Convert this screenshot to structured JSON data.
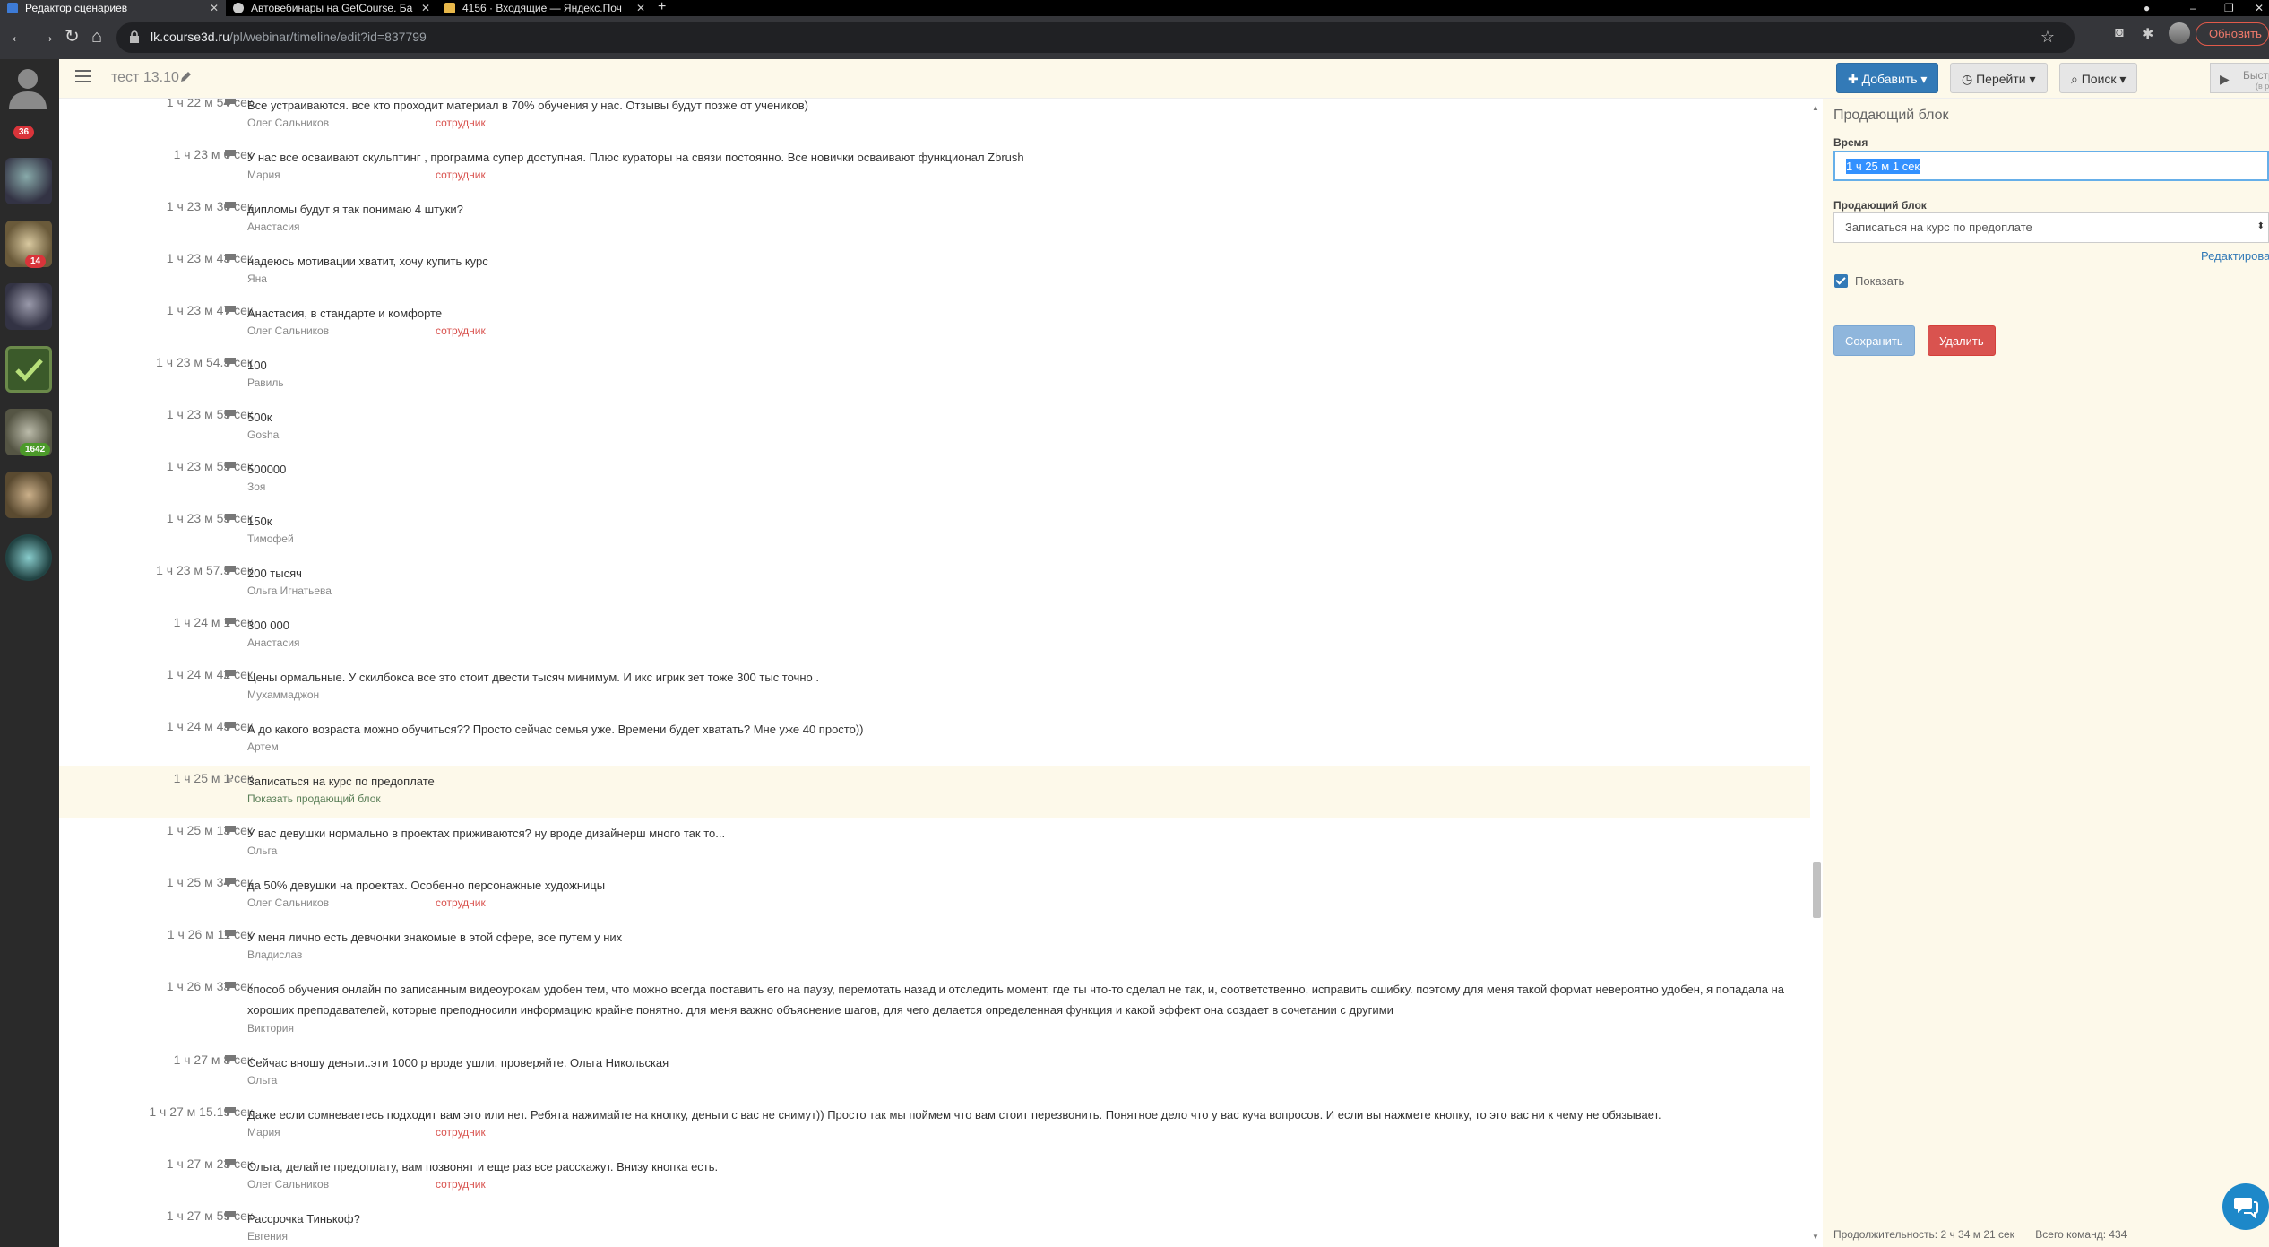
{
  "browser": {
    "tabs": [
      {
        "title": "Редактор сценариев",
        "active": true,
        "favicon_color": "#3d7bd6"
      },
      {
        "title": "Автовебинары на GetCourse. Ба",
        "active": false,
        "favicon_color": "#cccccc"
      },
      {
        "title": "4156 · Входящие — Яндекс.Поч",
        "active": false,
        "favicon_color": "#e8b84a"
      }
    ],
    "new_tab": "+",
    "url_host": "lk.course3d.ru",
    "url_path": "/pl/webinar/timeline/edit?id=837799",
    "update_label": "Обновить",
    "icons": [
      "back-icon",
      "forward-icon",
      "reload-icon",
      "home-icon",
      "lock-icon",
      "star-icon",
      "camera-icon",
      "puzzle-icon"
    ]
  },
  "sidebar": {
    "badges": [
      {
        "label": "36",
        "color": "#d9343a"
      },
      {
        "label": "14",
        "color": "#d9343a"
      },
      {
        "label": "1642",
        "color": "#4c9a2a"
      }
    ]
  },
  "header": {
    "title": "тест 13.10",
    "add_label": "Добавить",
    "goto_label": "Перейти",
    "search_label": "Поиск",
    "quick_check": "Быстрая проверка",
    "quick_check_sub": "(в разработке)"
  },
  "timeline": {
    "rows": [
      {
        "time": "1 ч 22 м 54 сек",
        "text": "Все устраиваются. все кто проходит материал в 70% обучения у нас. Отзывы будут позже от учеников)",
        "author": "Олег Сальников",
        "role": "сотрудник"
      },
      {
        "time": "1 ч 23 м 6 сек",
        "text": "У нас все осваивают скульптинг , программа супер доступная. Плюс кураторы на связи постоянно. Все новички осваивают функционал Zbrush",
        "author": "Мария",
        "role": "сотрудник"
      },
      {
        "time": "1 ч 23 м 36 сек",
        "text": "дипломы будут я так понимаю 4 штуки?",
        "author": "Анастасия",
        "role": ""
      },
      {
        "time": "1 ч 23 м 43 сек",
        "text": "надеюсь мотивации хватит, хочу купить курс",
        "author": "Яна",
        "role": ""
      },
      {
        "time": "1 ч 23 м 47 сек",
        "text": "Анастасия, в стандарте и комфорте",
        "author": "Олег Сальников",
        "role": "сотрудник"
      },
      {
        "time": "1 ч 23 м 54.5 сек",
        "text": "100",
        "author": "Равиль",
        "role": ""
      },
      {
        "time": "1 ч 23 м 55 сек",
        "text": "500к",
        "author": "Gosha",
        "role": ""
      },
      {
        "time": "1 ч 23 м 55 сек",
        "text": "500000",
        "author": "Зоя",
        "role": ""
      },
      {
        "time": "1 ч 23 м 55 сек",
        "text": "150к",
        "author": "Тимофей",
        "role": ""
      },
      {
        "time": "1 ч 23 м 57.5 сек",
        "text": "200 тысяч",
        "author": "Ольга Игнатьева",
        "role": ""
      },
      {
        "time": "1 ч 24 м 1 сек",
        "text": "300 000",
        "author": "Анастасия",
        "role": ""
      },
      {
        "time": "1 ч 24 м 42 сек",
        "text": "Цены ормальные. У скилбокса все это стоит двести тысяч минимум. И икс игрик зет тоже 300 тыс точно .",
        "author": "Мухаммаджон",
        "role": ""
      },
      {
        "time": "1 ч 24 м 45 сек",
        "text": "А до какого возраста можно обучиться?? Просто сейчас семья уже. Времени будет хватать? Мне уже 40 просто))",
        "author": "Артем",
        "role": ""
      },
      {
        "time": "1 ч 25 м 1 сек",
        "text": "Записаться на курс по предоплате",
        "author": "",
        "role": "",
        "link": "Показать продающий блок",
        "sale": true
      },
      {
        "time": "1 ч 25 м 13 сек",
        "text": "У вас девушки нормально в проектах приживаются? ну вроде дизайнерш много так то...",
        "author": "Ольга",
        "role": ""
      },
      {
        "time": "1 ч 25 м 34 сек",
        "text": "да 50% девушки на проектах. Особенно персонажные художницы",
        "author": "Олег Сальников",
        "role": "сотрудник"
      },
      {
        "time": "1 ч 26 м 11 сек",
        "text": "У меня лично есть девчонки знакомые в этой сфере, все путем у них",
        "author": "Владислав",
        "role": ""
      },
      {
        "time": "1 ч 26 м 33 сек",
        "text": "способ обучения онлайн по записанным видеоурокам удобен тем, что можно всегда поставить его на паузу, перемотать назад и отследить момент, где ты что-то сделал не так, и, соответственно, исправить ошибку. поэтому для меня такой формат невероятно удобен, я попадала на хороших преподавателей, которые преподносили информацию крайне понятно. для меня важно объяснение шагов, для чего делается определенная функция и какой эффект она создает в сочетании с другими",
        "author": "Виктория",
        "role": ""
      },
      {
        "time": "1 ч 27 м 8 сек",
        "text": "Сейчас вношу деньги..эти 1000 р вроде ушли, проверяйте. Ольга Никольская",
        "author": "Ольга",
        "role": ""
      },
      {
        "time": "1 ч 27 м 15.19 сек",
        "text": "Даже если сомневаетесь подходит вам это или нет. Ребята нажимайте на кнопку, деньги с вас не снимут)) Просто так мы поймем что вам стоит перезвонить. Понятное дело что у вас куча вопросов. И если вы нажмете кнопку, то это вас ни к чему не обязывает.",
        "author": "Мария",
        "role": "сотрудник"
      },
      {
        "time": "1 ч 27 м 23 сек",
        "text": "Ольга, делайте предоплату, вам позвонят и еще раз все расскажут. Внизу кнопка есть.",
        "author": "Олег Сальников",
        "role": "сотрудник"
      },
      {
        "time": "1 ч 27 м 59 сек",
        "text": "Рассрочка Тинькоф?",
        "author": "Евгения",
        "role": ""
      }
    ]
  },
  "panel": {
    "title": "Продающий блок",
    "time_label": "Время",
    "time_value": "1 ч 25 м 1 сек",
    "block_label": "Продающий блок",
    "block_value": "Записаться на курс по предоплате",
    "edit_link": "Редактирова",
    "show_label": "Показать",
    "show_checked": true,
    "save_label": "Сохранить",
    "delete_label": "Удалить",
    "duration": "Продолжительность: 2 ч 34 м 21 сек",
    "total": "Всего команд: 434"
  },
  "colors": {
    "accent": "#337ab7",
    "danger": "#d9534f",
    "role": "#d9534f",
    "panel_bg": "#fdf9ea"
  }
}
